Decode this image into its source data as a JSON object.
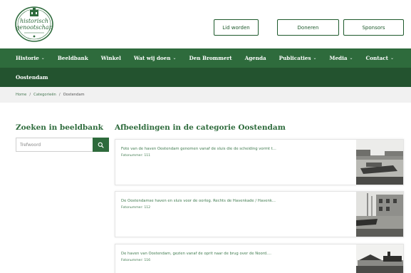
{
  "logo": {
    "line1": "historisch",
    "line2": "genootschap",
    "alt": "historisch genootschap logo"
  },
  "header_buttons": [
    "Lid worden",
    "Doneren",
    "Sponsors"
  ],
  "nav": {
    "items": [
      {
        "label": "Historie",
        "dropdown": true
      },
      {
        "label": "Beeldbank",
        "dropdown": false
      },
      {
        "label": "Winkel",
        "dropdown": false
      },
      {
        "label": "Wat wij doen",
        "dropdown": true
      },
      {
        "label": "Den Brommert",
        "dropdown": false
      },
      {
        "label": "Agenda",
        "dropdown": false
      },
      {
        "label": "Publicaties",
        "dropdown": true
      },
      {
        "label": "Media",
        "dropdown": true
      },
      {
        "label": "Contact",
        "dropdown": true
      }
    ],
    "chevron": "⌄"
  },
  "subnav": {
    "active": "Oostendam"
  },
  "breadcrumb": {
    "items": [
      "Home",
      "Categorieën"
    ],
    "current": "Oostendam",
    "separator": "/"
  },
  "search": {
    "title": "Zoeken in beeldbank",
    "placeholder": "Trefwoord",
    "button_icon": "search-icon"
  },
  "gallery": {
    "title": "Afbeeldingen in de categorie Oostendam",
    "cards": [
      {
        "description": "Foto van de haven Oostendam genomen vanaf de sluis die de scheiding vormt t...",
        "meta": "Fotonummer: 111"
      },
      {
        "description": "De Oostendamse haven en sluis voor de oorlog. Rechts de Havenkade / Havenk...",
        "meta": "Fotonummer: 112"
      },
      {
        "description": "De haven van Oostendam, gezien vanaf de oprit naar de brug over de Noord....",
        "meta": "Fotonummer: 116"
      }
    ]
  },
  "colors": {
    "primary": "#2e6b3c",
    "subnav": "#23532f",
    "breadcrumb_bg": "#f1f1f1"
  }
}
